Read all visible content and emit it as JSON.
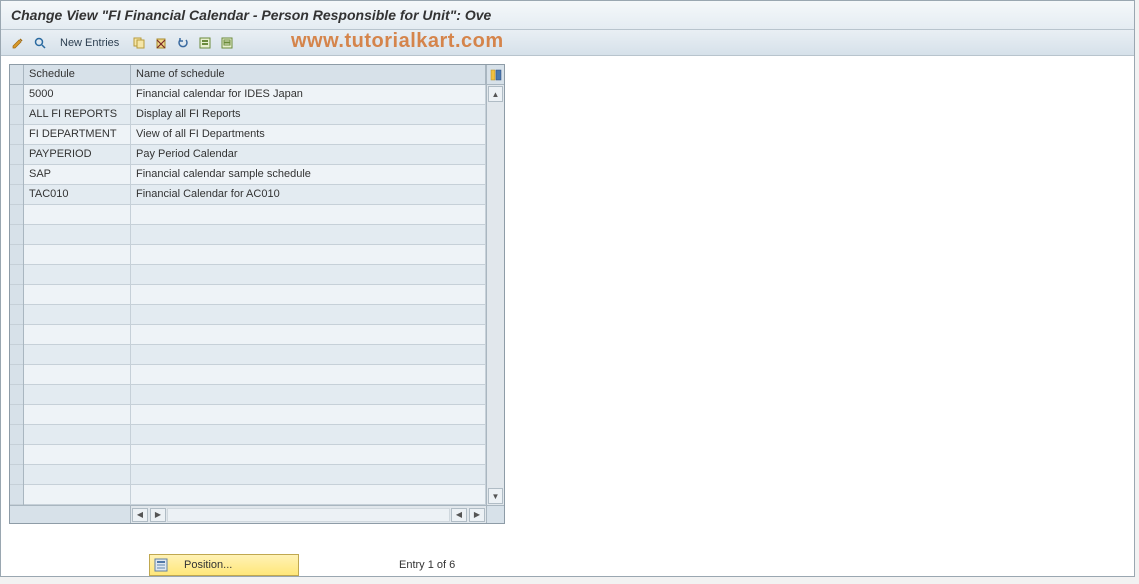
{
  "window": {
    "title": "Change View \"FI Financial Calendar - Person Responsible for Unit\": Ove"
  },
  "toolbar": {
    "new_entries_label": "New Entries"
  },
  "watermark": "www.tutorialkart.com",
  "grid": {
    "headers": {
      "schedule": "Schedule",
      "name": "Name of schedule"
    },
    "rows": [
      {
        "schedule": "5000",
        "name": "Financial calendar for IDES Japan"
      },
      {
        "schedule": "ALL FI REPORTS",
        "name": "Display all FI Reports"
      },
      {
        "schedule": "FI DEPARTMENT",
        "name": "View of all FI Departments"
      },
      {
        "schedule": "PAYPERIOD",
        "name": "Pay Period Calendar"
      },
      {
        "schedule": "SAP",
        "name": "Financial calendar sample schedule"
      },
      {
        "schedule": "TAC010",
        "name": "Financial Calendar for AC010"
      }
    ],
    "empty_row_count": 15
  },
  "footer": {
    "position_label": "Position...",
    "entry_text": "Entry 1 of 6"
  }
}
